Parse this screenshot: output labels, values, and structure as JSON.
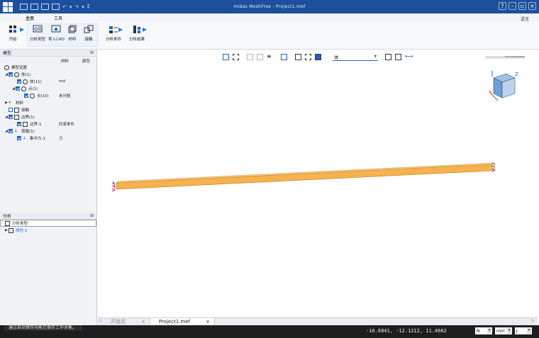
{
  "window": {
    "title": "midas MeshFree - Project1.mef"
  },
  "ribbon": {
    "tabs": [
      {
        "label": "主页",
        "active": true
      },
      {
        "label": "工具",
        "active": false
      }
    ],
    "language_label": "语言",
    "buttons": {
      "start": "开始",
      "analysis_type": "分析类型",
      "import_cad": "导入CAD",
      "material": "材料",
      "contact": "接触",
      "analysis_condition": "分析条件",
      "analysis_result": "分析结果"
    }
  },
  "model_panel": {
    "title": "模型",
    "col_material": "材料",
    "col_color": "颜色",
    "tree": [
      {
        "label": "模型设置",
        "value": ""
      },
      {
        "label": "体(1)",
        "value": ""
      },
      {
        "label": "体(11)",
        "value": "rod"
      },
      {
        "label": "点(1)",
        "value": ""
      },
      {
        "label": "点(10)",
        "value": "未分配"
      },
      {
        "label": "材料",
        "value": ""
      },
      {
        "label": "接触",
        "value": ""
      },
      {
        "label": "边界(1)",
        "value": ""
      },
      {
        "label": "边界-1",
        "value": "约束条件"
      },
      {
        "label": "荷载(1)",
        "value": ""
      },
      {
        "label": "集中力-1",
        "value": "力"
      }
    ]
  },
  "analysis_panel": {
    "title": "分析",
    "tree": [
      {
        "label": "分析类型"
      },
      {
        "label": "线性-1"
      }
    ]
  },
  "viewport": {
    "selection_filter": "体"
  },
  "document_tabs": [
    {
      "label": "开始页",
      "active": false
    },
    {
      "label": "Project1.mef",
      "active": true
    }
  ],
  "status_bar": {
    "message": "通过自动保存功能已保存工作对象。",
    "coordinates": "-16.6841, -12.1212, 11.4662",
    "force_unit": "N",
    "length_unit": "mm",
    "energy_unit": "J"
  },
  "colors": {
    "titlebar": "#1c4f9c",
    "beam": "#f5b24f",
    "accent": "#1e62c9"
  }
}
